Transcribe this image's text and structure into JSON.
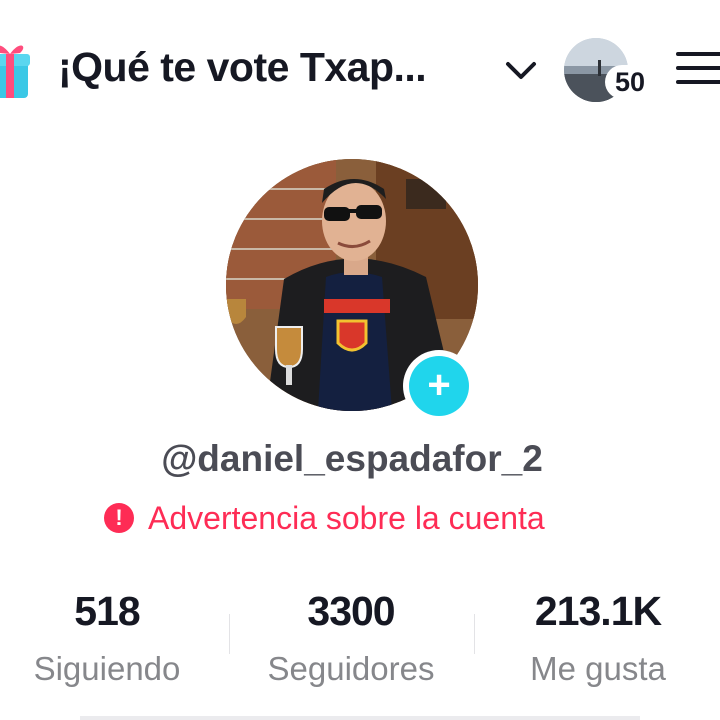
{
  "header": {
    "title": "¡Qué te vote Txap...",
    "notification_count": "50",
    "icons": {
      "gift": "gift-icon",
      "dropdown": "chevron-down-icon",
      "menu": "hamburger-menu-icon"
    }
  },
  "profile": {
    "username": "@daniel_espadafor_2",
    "add_label": "+",
    "warning_icon": "!",
    "warning_text": "Advertencia sobre la cuenta"
  },
  "stats": [
    {
      "value": "518",
      "label": "Siguiendo"
    },
    {
      "value": "3300",
      "label": "Seguidores"
    },
    {
      "value": "213.1K",
      "label": "Me gusta"
    }
  ],
  "colors": {
    "accent": "#fe2c55",
    "add_button": "#20d5ec",
    "text": "#161823",
    "muted": "#86878b"
  }
}
